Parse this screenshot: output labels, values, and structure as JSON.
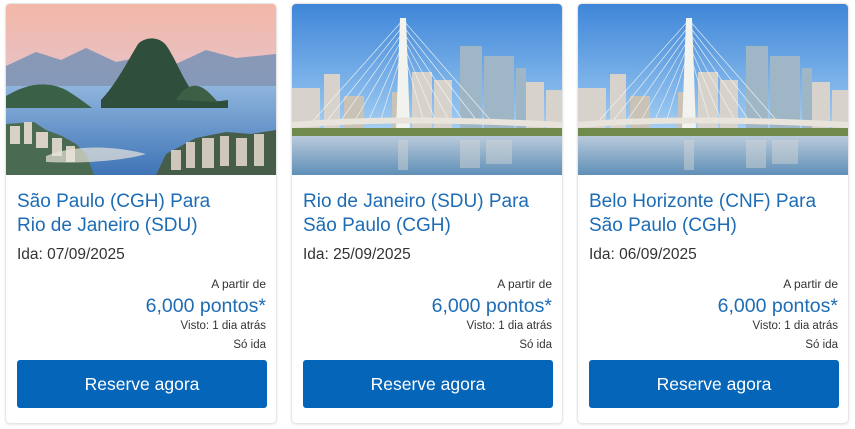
{
  "cards": [
    {
      "route_line1": "São Paulo (CGH) Para",
      "route_line2": "Rio de Janeiro (SDU)",
      "date": "Ida: 07/09/2025",
      "from_label": "A partir de",
      "price": "6,000 pontos*",
      "seen": "Visto: 1 dia atrás",
      "trip_type": "Só ida",
      "button_label": "Reserve agora",
      "image": "rio-de-janeiro-sugarloaf-photo"
    },
    {
      "route_line1": "Rio de Janeiro (SDU) Para",
      "route_line2": "São Paulo (CGH)",
      "date": "Ida: 25/09/2025",
      "from_label": "A partir de",
      "price": "6,000 pontos*",
      "seen": "Visto: 1 dia atrás",
      "trip_type": "Só ida",
      "button_label": "Reserve agora",
      "image": "sao-paulo-cable-bridge-photo"
    },
    {
      "route_line1": "Belo Horizonte (CNF) Para",
      "route_line2": "São Paulo (CGH)",
      "date": "Ida: 06/09/2025",
      "from_label": "A partir de",
      "price": "6,000 pontos*",
      "seen": "Visto: 1 dia atrás",
      "trip_type": "Só ida",
      "button_label": "Reserve agora",
      "image": "sao-paulo-cable-bridge-photo"
    }
  ],
  "colors": {
    "link_blue": "#1d6cb5",
    "button_blue": "#0565b8",
    "text": "#333333"
  }
}
